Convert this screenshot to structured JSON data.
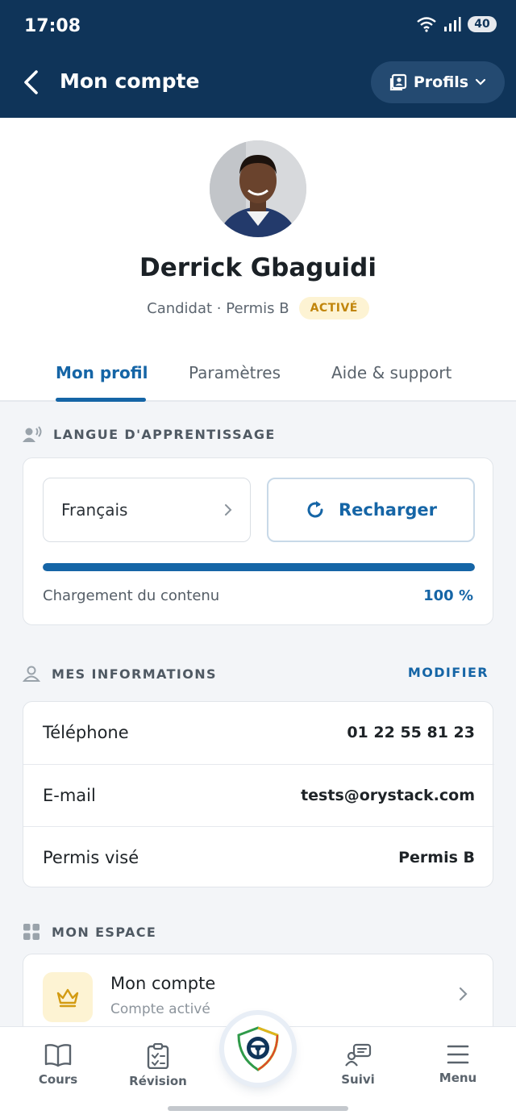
{
  "status_bar": {
    "time": "17:08",
    "battery": "40",
    "signal_label": "5"
  },
  "header": {
    "title": "Mon compte",
    "profiles_label": "Profils"
  },
  "profile": {
    "name": "Derrick Gbaguidi",
    "role": "Candidat · Permis B",
    "status_badge": "ACTIVÉ"
  },
  "tabs": [
    {
      "label": "Mon profil",
      "active": true
    },
    {
      "label": "Paramètres",
      "active": false
    },
    {
      "label": "Aide & support",
      "active": false
    }
  ],
  "language_section": {
    "title": "LANGUE D'APPRENTISSAGE",
    "selected_language": "Français",
    "reload_label": "Recharger",
    "progress_label": "Chargement du contenu",
    "progress_value": "100 %",
    "progress_fraction": 1.0
  },
  "info_section": {
    "title": "MES INFORMATIONS",
    "modify_label": "MODIFIER",
    "rows": [
      {
        "label": "Téléphone",
        "value": "01 22 55 81 23"
      },
      {
        "label": "E-mail",
        "value": "tests@orystack.com"
      },
      {
        "label": "Permis visé",
        "value": "Permis B"
      }
    ]
  },
  "space_section": {
    "title": "MON ESPACE",
    "items": [
      {
        "title": "Mon compte",
        "subtitle": "Compte activé",
        "icon": "crown-icon"
      }
    ]
  },
  "bottom_nav": [
    {
      "label": "Cours",
      "icon": "book-icon"
    },
    {
      "label": "Révision",
      "icon": "clipboard-check-icon"
    },
    {
      "label": "Suivi",
      "icon": "progress-chat-icon"
    },
    {
      "label": "Menu",
      "icon": "menu-icon"
    }
  ],
  "colors": {
    "header_bg": "#0f3459",
    "accent": "#1565a6",
    "badge_bg": "#fdf3d3",
    "badge_text": "#c1850b"
  }
}
